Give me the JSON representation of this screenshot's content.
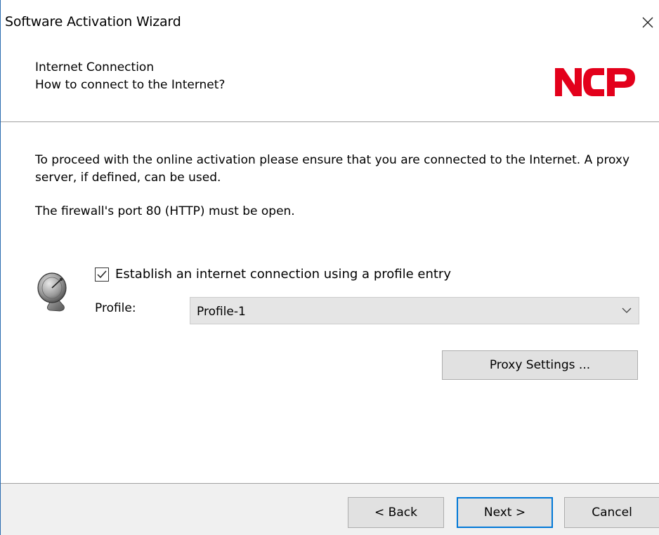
{
  "window": {
    "title": "Software Activation Wizard"
  },
  "header": {
    "title": "Internet Connection",
    "subtitle": "How to connect to the Internet?",
    "logo_text": "NCP",
    "logo_color": "#e3001b"
  },
  "content": {
    "paragraph1": "To proceed with the online activation please ensure that you are connected to the Internet. A proxy server, if defined, can be used.",
    "paragraph2": "The firewall's port 80 (HTTP) must be open.",
    "checkbox_label": "Establish an internet connection using a profile entry",
    "checkbox_checked": true,
    "profile_label": "Profile:",
    "profile_value": "Profile-1",
    "proxy_button": "Proxy Settings ..."
  },
  "footer": {
    "back_button": "< Back",
    "next_button": "Next >",
    "cancel_button": "Cancel"
  },
  "colors": {
    "focus_border": "#0078d7",
    "window_border": "#2b6cb0"
  },
  "icons": {
    "close": "close-icon",
    "dish": "satellite-dish-icon",
    "check": "checkmark-icon",
    "dropdown": "chevron-down-icon"
  }
}
